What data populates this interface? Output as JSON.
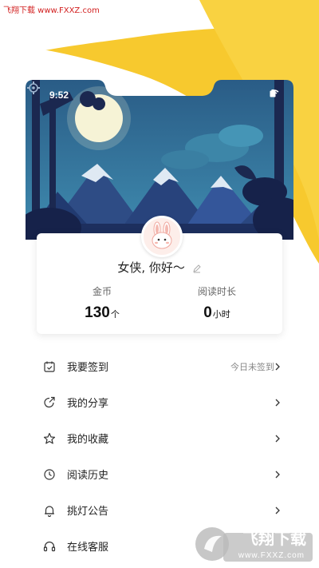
{
  "watermark": {
    "top_text": "飞翔下载 www.FXXZ.com",
    "logo_text": "飞翔下载",
    "logo_url": "www.FXXZ.com"
  },
  "status_bar": {
    "time": "9:52"
  },
  "profile": {
    "greeting": "女侠, 你好～",
    "coins": {
      "label": "金币",
      "value": "130",
      "unit": "个"
    },
    "reading": {
      "label": "阅读时长",
      "value": "0",
      "unit": "小时"
    }
  },
  "menu": [
    {
      "label": "我要签到",
      "status": "今日未签到",
      "icon": "calendar-check-icon"
    },
    {
      "label": "我的分享",
      "status": "",
      "icon": "share-icon"
    },
    {
      "label": "我的收藏",
      "status": "",
      "icon": "star-icon"
    },
    {
      "label": "阅读历史",
      "status": "",
      "icon": "clock-icon"
    },
    {
      "label": "挑灯公告",
      "status": "",
      "icon": "bell-icon"
    },
    {
      "label": "在线客服",
      "status": "",
      "icon": "headset-icon"
    }
  ],
  "colors": {
    "accent_yellow": "#f7c92e",
    "sky": "#2f6a91",
    "mountain": "#24407a"
  }
}
